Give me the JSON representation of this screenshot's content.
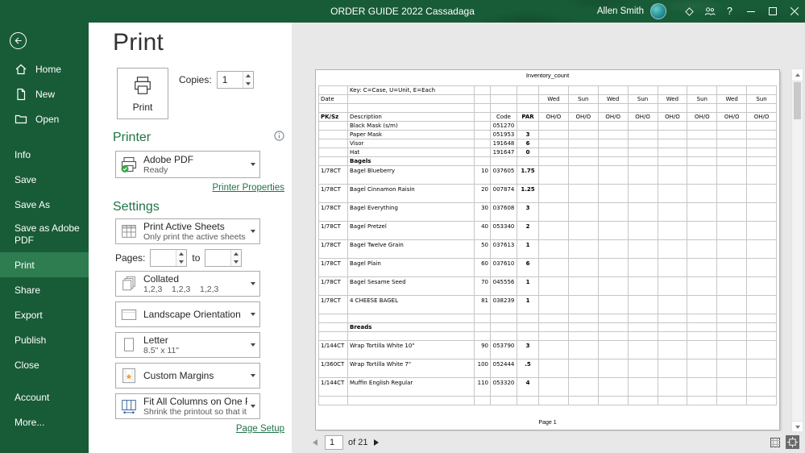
{
  "colors": {
    "titlebar_green": "#185C37",
    "selected_nav_green": "#2E7D51",
    "accent_green": "#217346",
    "printer_ready_check_green": "#3AA546",
    "preview_background": "#E8E8E8"
  },
  "titlebar": {
    "title": "ORDER GUIDE 2022 Cassadaga",
    "user_name": "Allen Smith",
    "help_label": "?"
  },
  "sidebar": {
    "nav_items": [
      {
        "id": "home",
        "label": "Home",
        "icon": "home-icon"
      },
      {
        "id": "new",
        "label": "New",
        "icon": "new-document-icon"
      },
      {
        "id": "open",
        "label": "Open",
        "icon": "open-folder-icon"
      }
    ],
    "file_items": [
      {
        "id": "info",
        "label": "Info"
      },
      {
        "id": "save",
        "label": "Save"
      },
      {
        "id": "save-as",
        "label": "Save As"
      },
      {
        "id": "save-as-adobe-pdf",
        "label": "Save as Adobe PDF"
      },
      {
        "id": "print",
        "label": "Print",
        "selected": true
      },
      {
        "id": "share",
        "label": "Share"
      },
      {
        "id": "export",
        "label": "Export"
      },
      {
        "id": "publish",
        "label": "Publish"
      },
      {
        "id": "close",
        "label": "Close"
      }
    ],
    "footer_items": [
      {
        "id": "account",
        "label": "Account"
      },
      {
        "id": "more",
        "label": "More..."
      }
    ]
  },
  "print_page": {
    "title": "Print",
    "print_button_label": "Print",
    "copies_label": "Copies:",
    "copies_value": "1",
    "printer_section": {
      "heading": "Printer",
      "device_name": "Adobe PDF",
      "device_status": "Ready",
      "properties_link": "Printer Properties"
    },
    "settings": {
      "heading": "Settings",
      "what_to_print": {
        "title": "Print Active Sheets",
        "subtitle": "Only print the active sheets"
      },
      "pages": {
        "label": "Pages:",
        "to_label": "to",
        "from_value": "",
        "to_value": ""
      },
      "collation": {
        "title": "Collated",
        "subtitle": "1,2,3    1,2,3    1,2,3"
      },
      "orientation": {
        "title": "Landscape Orientation"
      },
      "paper_size": {
        "title": "Letter",
        "subtitle": "8.5\" x 11\""
      },
      "margins": {
        "title": "Custom Margins"
      },
      "scaling": {
        "title": "Fit All Columns on One Page",
        "subtitle": "Shrink the printout so that it..."
      },
      "page_setup_link": "Page Setup"
    }
  },
  "preview": {
    "sheet_title": "Inventory_count",
    "page_label": "Page 1",
    "key_text": "Key: C=Case, U=Unit, E=Each",
    "date_label": "Date",
    "day_headers": [
      "Wed",
      "Sun",
      "Wed",
      "Sun",
      "Wed",
      "Sun",
      "Wed",
      "Sun"
    ],
    "columns": {
      "pksz": "PK/Sz",
      "description": "Description",
      "code": "Code",
      "par": "PAR",
      "oho": "OH/O"
    },
    "oho_count": 8,
    "rows": [
      {
        "type": "key"
      },
      {
        "type": "date"
      },
      {
        "type": "empty"
      },
      {
        "type": "header"
      },
      {
        "type": "item",
        "pksz": "",
        "desc": "Black Mask (s/m)",
        "num": "",
        "code": "051270",
        "par": "",
        "h": "std"
      },
      {
        "type": "item",
        "pksz": "",
        "desc": "Paper Mask",
        "num": "",
        "code": "051953",
        "par": "3",
        "h": "std"
      },
      {
        "type": "item",
        "pksz": "",
        "desc": "Visor",
        "num": "",
        "code": "191648",
        "par": "6",
        "h": "std"
      },
      {
        "type": "item",
        "pksz": "",
        "desc": "Hat",
        "num": "",
        "code": "191647",
        "par": "0",
        "h": "std"
      },
      {
        "type": "section",
        "label": "Bagels"
      },
      {
        "type": "item",
        "pksz": "1/78CT",
        "desc": "Bagel Blueberry",
        "num": "10",
        "code": "037605",
        "par": "1.75",
        "h": "tall"
      },
      {
        "type": "item",
        "pksz": "1/78CT",
        "desc": "Bagel Cinnamon Raisin",
        "num": "20",
        "code": "007874",
        "par": "1.25",
        "h": "tall"
      },
      {
        "type": "item",
        "pksz": "1/78CT",
        "desc": "Bagel Everything",
        "num": "30",
        "code": "037608",
        "par": "3",
        "h": "tall"
      },
      {
        "type": "item",
        "pksz": "1/78CT",
        "desc": "Bagel Pretzel",
        "num": "40",
        "code": "053340",
        "par": "2",
        "h": "tall"
      },
      {
        "type": "item",
        "pksz": "1/78CT",
        "desc": "Bagel Twelve Grain",
        "num": "50",
        "code": "037613",
        "par": "1",
        "h": "tall"
      },
      {
        "type": "item",
        "pksz": "1/78CT",
        "desc": "Bagel Plain",
        "num": "60",
        "code": "037610",
        "par": "6",
        "h": "tall"
      },
      {
        "type": "item",
        "pksz": "1/78CT",
        "desc": "Bagel Sesame Seed",
        "num": "70",
        "code": "045556",
        "par": "1",
        "h": "tall"
      },
      {
        "type": "item",
        "pksz": "1/78CT",
        "desc": "4 CHEESE BAGEL",
        "num": "81",
        "code": "038239",
        "par": "1",
        "h": "tall"
      },
      {
        "type": "empty"
      },
      {
        "type": "section",
        "label": "Breads"
      },
      {
        "type": "empty"
      },
      {
        "type": "item",
        "pksz": "1/144CT",
        "desc": "Wrap Tortilla White 10\"",
        "num": "90",
        "code": "053790",
        "par": "3",
        "h": "tall"
      },
      {
        "type": "item",
        "pksz": "1/360CT",
        "desc": "Wrap Tortilla White 7\"",
        "num": "100",
        "code": "052444",
        "par": ".5",
        "h": "tall"
      },
      {
        "type": "item",
        "pksz": "1/144CT",
        "desc": "Muffin English Regular",
        "num": "110",
        "code": "053320",
        "par": "4",
        "h": "tall"
      },
      {
        "type": "empty"
      }
    ],
    "nav": {
      "current_page": "1",
      "of_label": "of 21"
    }
  }
}
